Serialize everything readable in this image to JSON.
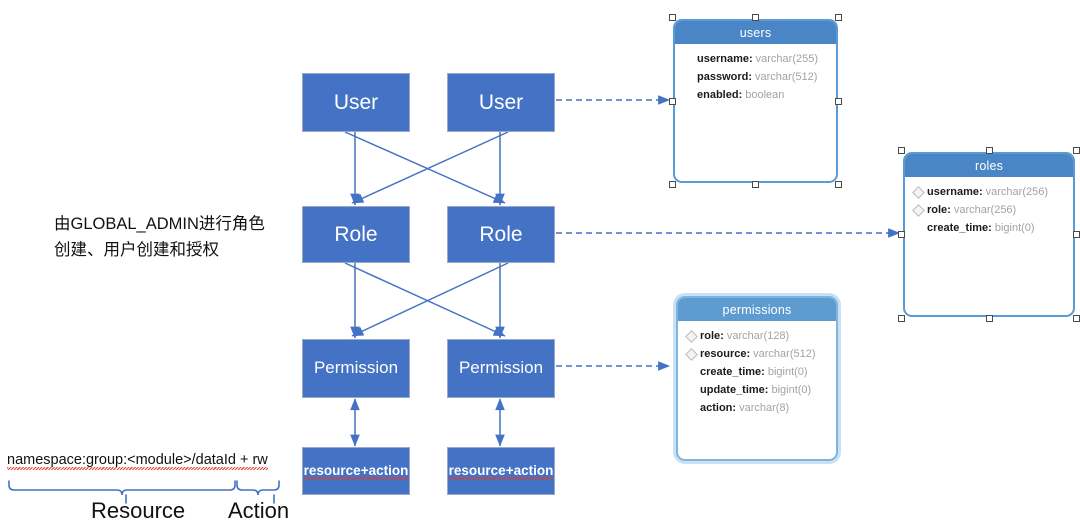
{
  "diagram": {
    "title_note": "由GLOBAL_ADMIN进行角色创建、用户创建和授权",
    "accent_blue": "#4472c4",
    "table_header_blue": "#4a86c5",
    "connector_blue": "#4472c4",
    "squiggle_red": "#e23b32"
  },
  "flow": {
    "user_left": "User",
    "user_right": "User",
    "role_left": "Role",
    "role_right": "Role",
    "permission_left": "Permission",
    "permission_right": "Permission",
    "resource_action_left": "resource+action",
    "resource_action_right": "resource+action"
  },
  "legend": {
    "pattern": "namespace:group:<module>/dataId + rw",
    "resource_label": "Resource",
    "action_label": "Action"
  },
  "tables": [
    {
      "id": "users",
      "name": "users",
      "selected": true,
      "fields": [
        {
          "name": "username",
          "type": "varchar(255)",
          "key": false
        },
        {
          "name": "password",
          "type": "varchar(512)",
          "key": false
        },
        {
          "name": "enabled",
          "type": "boolean",
          "key": false
        }
      ]
    },
    {
      "id": "roles",
      "name": "roles",
      "selected": true,
      "fields": [
        {
          "name": "username",
          "type": "varchar(256)",
          "key": true
        },
        {
          "name": "role",
          "type": "varchar(256)",
          "key": true
        },
        {
          "name": "create_time",
          "type": "bigint(0)",
          "key": false
        }
      ]
    },
    {
      "id": "permissions",
      "name": "permissions",
      "selected": false,
      "fields": [
        {
          "name": "role",
          "type": "varchar(128)",
          "key": true
        },
        {
          "name": "resource",
          "type": "varchar(512)",
          "key": true
        },
        {
          "name": "create_time",
          "type": "bigint(0)",
          "key": false
        },
        {
          "name": "update_time",
          "type": "bigint(0)",
          "key": false
        },
        {
          "name": "action",
          "type": "varchar(8)",
          "key": false
        }
      ]
    }
  ]
}
